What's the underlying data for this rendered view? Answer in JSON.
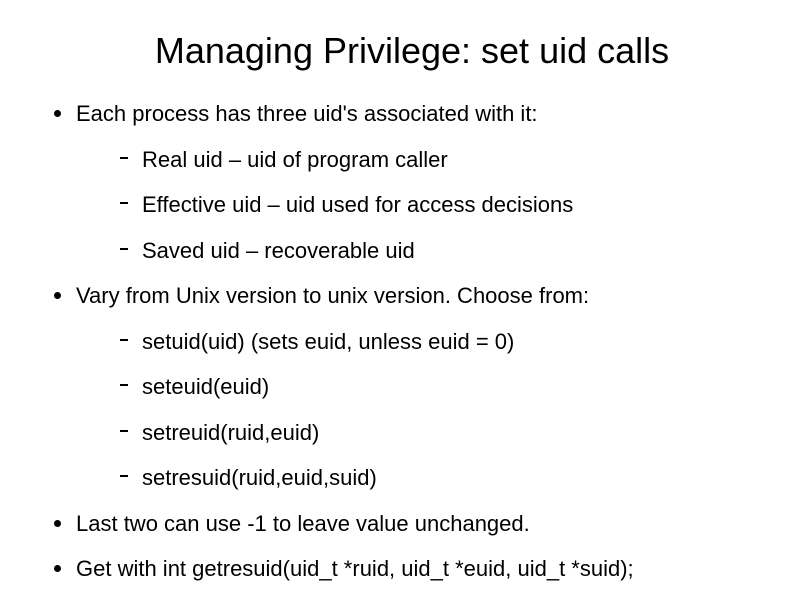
{
  "title": "Managing Privilege: set uid calls",
  "bullets": [
    {
      "text": "Each process has three uid's associated with it:",
      "sub": [
        "Real uid – uid of program caller",
        "Effective uid – uid used for access decisions",
        "Saved uid – recoverable uid"
      ]
    },
    {
      "text": "Vary from Unix version to unix version. Choose from:",
      "sub": [
        "setuid(uid) (sets euid, unless euid = 0)",
        "seteuid(euid)",
        "setreuid(ruid,euid)",
        "setresuid(ruid,euid,suid)"
      ]
    },
    {
      "text": "Last two can use -1 to leave value unchanged.",
      "sub": []
    },
    {
      "text": "Get with int getresuid(uid_t *ruid, uid_t *euid, uid_t *suid);",
      "sub": []
    }
  ]
}
